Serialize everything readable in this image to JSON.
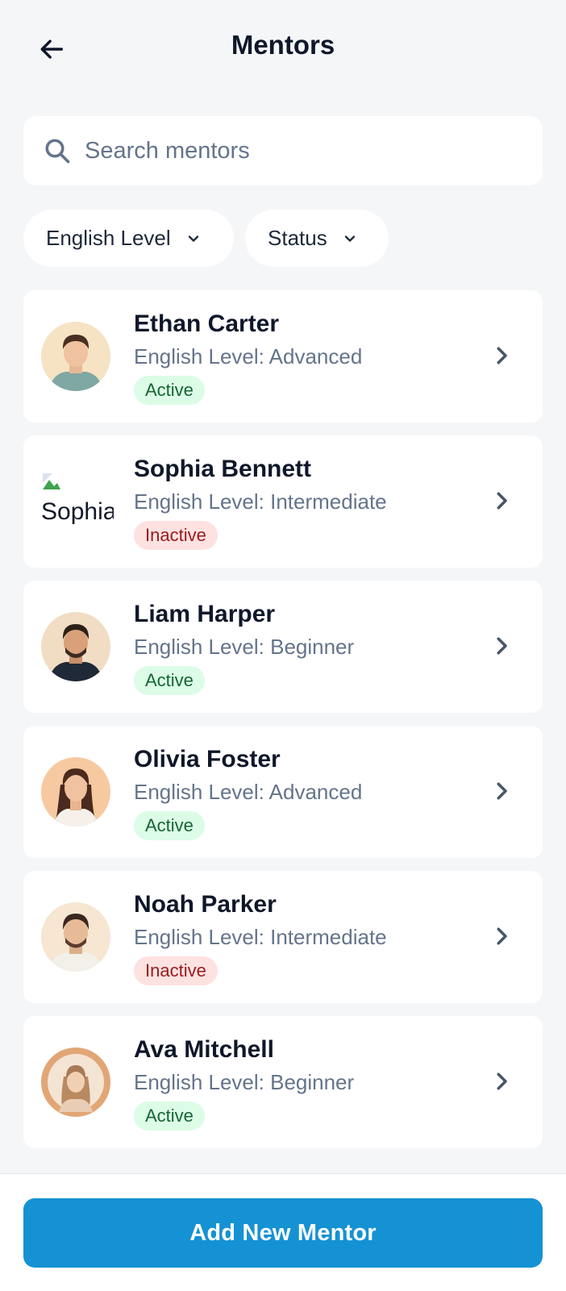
{
  "header": {
    "title": "Mentors",
    "back_icon": "arrow-left-icon"
  },
  "search": {
    "placeholder": "Search mentors",
    "value": "",
    "icon": "search-icon"
  },
  "filters": [
    {
      "label": "English Level",
      "icon": "chevron-down-icon"
    },
    {
      "label": "Status",
      "icon": "chevron-down-icon"
    }
  ],
  "mentors": [
    {
      "name": "Ethan Carter",
      "level": "English Level: Advanced",
      "status": "Active"
    },
    {
      "name": "Sophia Bennett",
      "level": "English Level: Intermediate",
      "status": "Inactive",
      "avatar_alt": "Sophia"
    },
    {
      "name": "Liam Harper",
      "level": "English Level: Beginner",
      "status": "Active"
    },
    {
      "name": "Olivia Foster",
      "level": "English Level: Advanced",
      "status": "Active"
    },
    {
      "name": "Noah Parker",
      "level": "English Level: Intermediate",
      "status": "Inactive"
    },
    {
      "name": "Ava Mitchell",
      "level": "English Level: Beginner",
      "status": "Active"
    }
  ],
  "footer": {
    "add_button": "Add New Mentor"
  },
  "colors": {
    "accent": "#1492d4",
    "active_bg": "#dcfce7",
    "active_text": "#166534",
    "inactive_bg": "#fee2e2",
    "inactive_text": "#991b1b"
  }
}
